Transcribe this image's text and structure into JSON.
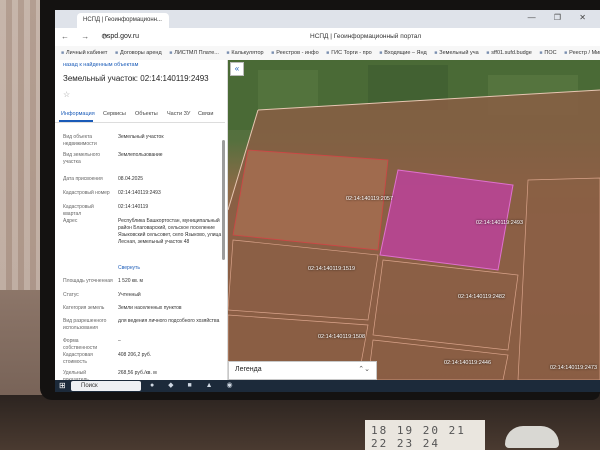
{
  "browser": {
    "tab_label": "НСПД | Геоинформационн...",
    "tab2_label": "НСПД | Геоинформационный портал",
    "url": "nspd.gov.ru",
    "bookmarks": [
      "Личный кабинет",
      "Договоры аренд",
      "ЛИСТМЛ Плате...",
      "Калькулятор",
      "Реестров - инфо",
      "ГИС Торги - про",
      "Входящие – Янд",
      "Земельный уча",
      "sff01.sufd.budge",
      "ПОС",
      "Реестр / Минис"
    ]
  },
  "panel": {
    "back_link": "назад к найденным объектам",
    "title": "Земельный участок: 02:14:140119:2493",
    "tabs": [
      "Информация",
      "Сервисы",
      "Объекты",
      "Части ЗУ",
      "Связи"
    ],
    "fields": [
      {
        "label": "Вид объекта недвижимости",
        "value": "Земельный участок"
      },
      {
        "label": "Вид земельного участка",
        "value": "Землепользование"
      },
      {
        "label": "Дата присвоения",
        "value": "08.04.2025"
      },
      {
        "label": "Кадастровый номер",
        "value": "02:14:140119:2493"
      },
      {
        "label": "Кадастровый квартал",
        "value": "02:14:140119"
      },
      {
        "label": "Адрес",
        "value": "Республика Башкортостан, муниципальный район Благоварский, сельское поселение Языковский сельсовет, село Языково, улица Лесная, земельный участок 48"
      },
      {
        "label": "",
        "value": "Свернуть"
      },
      {
        "label": "Площадь уточненная",
        "value": "1 520 кв. м"
      },
      {
        "label": "Статус",
        "value": "Учтенный"
      },
      {
        "label": "Категория земель",
        "value": "Земли населенных пунктов"
      },
      {
        "label": "Вид разрешенного использования",
        "value": "для ведения личного подсобного хозяйства"
      },
      {
        "label": "Форма собственности",
        "value": "–"
      },
      {
        "label": "Кадастровая стоимость",
        "value": "408 206,2 руб."
      },
      {
        "label": "Удельный показатель",
        "value": "268,56 руб./кв. м"
      }
    ]
  },
  "map": {
    "lots": [
      "02:14:140119:2057",
      "02:14:140119:2493",
      "02:14:140119:1519",
      "02:14:140119:2482",
      "02:14:140119:1508",
      "02:14:140119:2446",
      "02:14:140119:2473"
    ],
    "highlight_color": "#c23fa6",
    "legend_label": "Легенда"
  },
  "taskbar": {
    "search_label": "Поиск"
  },
  "calendar_text": "18 19 20 21 22 23 24"
}
